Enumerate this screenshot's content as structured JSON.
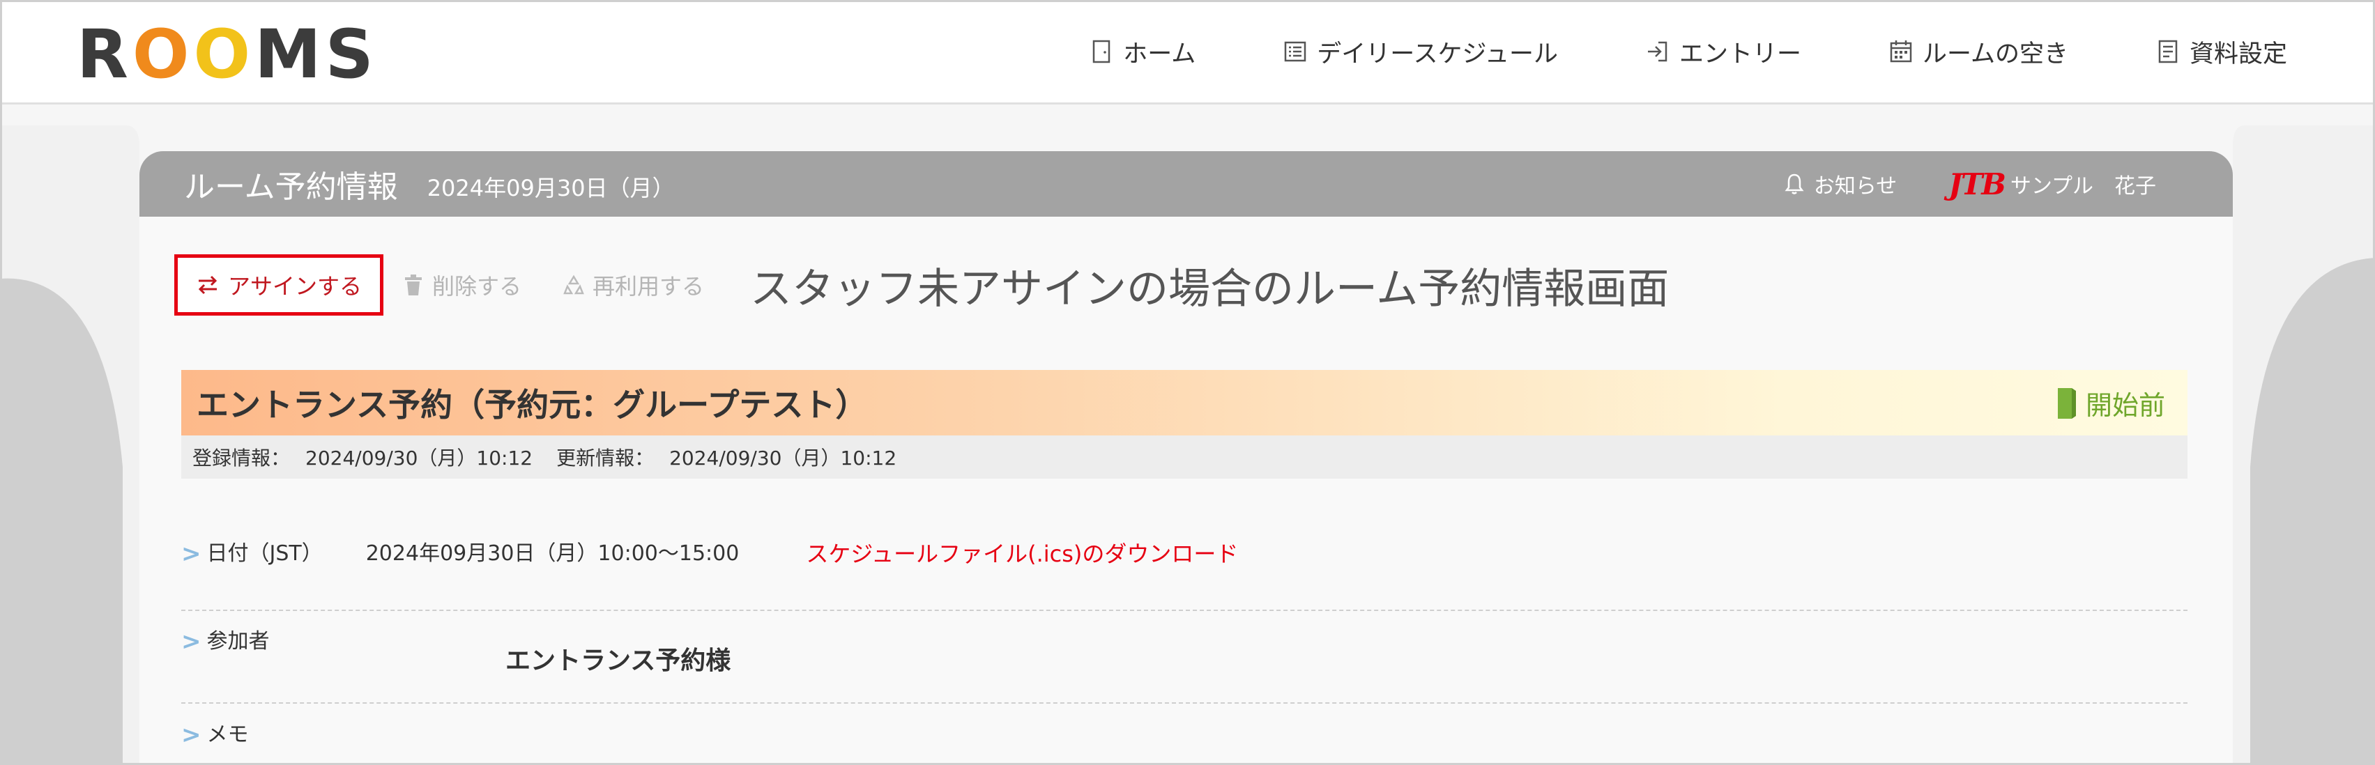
{
  "app": {
    "logo_letters": [
      "R",
      "O",
      "O",
      "M",
      "S"
    ],
    "colors": {
      "logo_dark": "#3c3c3c",
      "logo_orange": "#f08a1c",
      "logo_yellow": "#f2c21a",
      "accent_red": "#e60012",
      "status_green": "#6fa62b",
      "header_gray": "#a3a3a3"
    }
  },
  "nav": {
    "items": [
      {
        "label": "ホーム",
        "icon": "door-icon"
      },
      {
        "label": "デイリースケジュール",
        "icon": "list-icon"
      },
      {
        "label": "エントリー",
        "icon": "login-icon"
      },
      {
        "label": "ルームの空き",
        "icon": "calendar-icon"
      },
      {
        "label": "資料設定",
        "icon": "document-icon"
      }
    ]
  },
  "card": {
    "title": "ルーム予約情報",
    "date": "2024年09月30日（月）",
    "notice_label": "お知らせ",
    "brand_mark": "JTB",
    "user_name": "サンプル　花子"
  },
  "actions": {
    "assign_label": "アサインする",
    "delete_label": "削除する",
    "reuse_label": "再利用する"
  },
  "page_heading": "スタッフ未アサインの場合のルーム予約情報画面",
  "reservation": {
    "title": "エントランス予約（予約元：グループテスト）",
    "status": "開始前",
    "registered_label": "登録情報：",
    "registered_value": "2024/09/30（月）10:12",
    "updated_label": "更新情報：",
    "updated_value": "2024/09/30（月）10:12"
  },
  "details": {
    "date_label": "日付（JST）",
    "date_value": "2024年09月30日（月）10:00〜15:00",
    "ics_download": "スケジュールファイル(.ics)のダウンロード",
    "participants_label": "参加者",
    "participants_value": "エントランス予約様",
    "memo_label": "メモ"
  }
}
